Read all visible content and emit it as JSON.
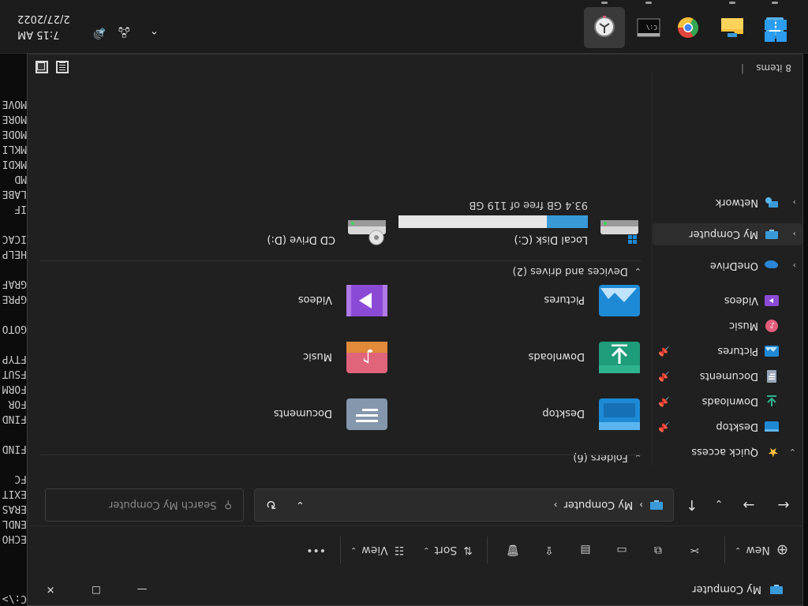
{
  "window": {
    "title": "My Computer",
    "controls": {
      "minimize": "—",
      "maximize": "☐",
      "close": "✕"
    }
  },
  "command_bar": {
    "new_label": "New",
    "sort_label": "Sort",
    "view_label": "View",
    "more_label": "•••"
  },
  "address": {
    "path_item": "My Computer",
    "search_placeholder": "Search My Computer"
  },
  "sidebar": {
    "quick_access": "Quick access",
    "items": [
      {
        "label": "Desktop",
        "icon": "desktop-folder-icon",
        "pinned": true
      },
      {
        "label": "Downloads",
        "icon": "downloads-folder-icon",
        "pinned": true
      },
      {
        "label": "Documents",
        "icon": "documents-folder-icon",
        "pinned": true
      },
      {
        "label": "Pictures",
        "icon": "pictures-folder-icon",
        "pinned": true
      },
      {
        "label": "Music",
        "icon": "music-folder-icon",
        "pinned": false
      },
      {
        "label": "Videos",
        "icon": "videos-folder-icon",
        "pinned": false
      }
    ],
    "onedrive": "OneDrive",
    "my_computer": "My Computer",
    "network": "Network"
  },
  "folders": {
    "header": "Folders (6)",
    "items": [
      "Desktop",
      "Documents",
      "Downloads",
      "Music",
      "Pictures",
      "Videos"
    ]
  },
  "devices": {
    "header": "Devices and drives (2)",
    "local_disk": {
      "name": "Local Disk (C:)",
      "free_text": "93.4 GB free of 119 GB",
      "used_fraction": 0.215
    },
    "cd_drive": {
      "name": "CD Drive (D:)"
    }
  },
  "status": {
    "items_count": "8 items"
  },
  "taskbar": {
    "time": "7:15 AM",
    "date": "2/27/2022"
  },
  "background_terminal": {
    "lines": [
      "C:\\>",
      "",
      "",
      "",
      "ECHO",
      "ENDL",
      "ERAS",
      "EXIT",
      "FC",
      "",
      "FIND",
      "",
      "FIND",
      "FOR",
      "FORM",
      "FSUT",
      "FTYP",
      "",
      "GOTO",
      "",
      "GPRE",
      "GRAF",
      "",
      "HELP",
      "ICAC",
      "",
      "IF",
      "LABE",
      "MD",
      "MKDI",
      "MKLI",
      "MODE",
      "MORE",
      "MOVE"
    ]
  },
  "colors": {
    "accent": "#3a9ad8",
    "folder_yellow": "#f5c13d",
    "window_bg": "#202020"
  }
}
